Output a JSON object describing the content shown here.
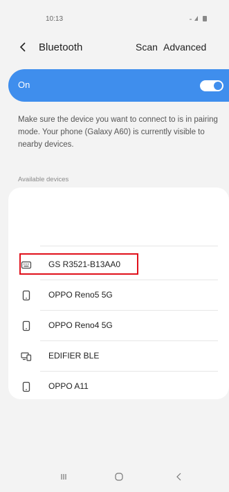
{
  "status_bar": {
    "time": "10:13",
    "icons": "wifi-signal-battery"
  },
  "header": {
    "title": "Bluetooth",
    "scan_label": "Scan",
    "advanced_label": "Advanced"
  },
  "toggle": {
    "label": "On",
    "state": true
  },
  "info_text": "Make sure the device you want to connect to is in pairing mode. Your phone (Galaxy A60) is currently visible to nearby devices.",
  "section_label": "Available devices",
  "devices": [
    {
      "name": "GS R3521-B13AA0",
      "icon": "keyboard-icon"
    },
    {
      "name": "OPPO Reno5 5G",
      "icon": "phone-icon"
    },
    {
      "name": "OPPO Reno4 5G",
      "icon": "phone-icon"
    },
    {
      "name": "EDIFIER BLE",
      "icon": "multi-device-icon"
    },
    {
      "name": "OPPO A11",
      "icon": "phone-icon"
    }
  ],
  "colors": {
    "accent": "#3f8eed",
    "highlight": "#e0101a",
    "background": "#f3f3f3"
  }
}
